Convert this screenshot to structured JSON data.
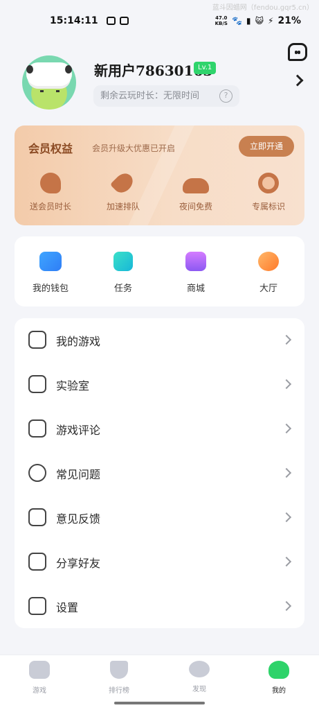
{
  "status_bar": {
    "time": "15:14:11",
    "net_speed_value": "47.0",
    "net_speed_unit": "KB/S",
    "battery": "21%"
  },
  "watermark": "蓝斗因蜡网（fendou.gqr5.cn）",
  "profile": {
    "username": "新用户78630163",
    "level": "Lv.1",
    "cloud_time_label": "剩余云玩时长：无限时间",
    "help_icon_text": "?"
  },
  "vip": {
    "title": "会员权益",
    "subtitle": "会员升级大优惠已开启",
    "open_button": "立即开通",
    "perks": [
      {
        "label": "送会员时长",
        "icon": "clock-icon"
      },
      {
        "label": "加速排队",
        "icon": "rocket-icon"
      },
      {
        "label": "夜间免费",
        "icon": "moon-cloud-icon"
      },
      {
        "label": "专属标识",
        "icon": "medal-icon"
      }
    ]
  },
  "quick_actions": [
    {
      "label": "我的钱包",
      "icon": "wallet-icon"
    },
    {
      "label": "任务",
      "icon": "task-icon"
    },
    {
      "label": "商城",
      "icon": "shop-icon"
    },
    {
      "label": "大厅",
      "icon": "hall-icon"
    }
  ],
  "menu": [
    {
      "label": "我的游戏",
      "icon": "gamepad-icon"
    },
    {
      "label": "实验室",
      "icon": "flask-icon"
    },
    {
      "label": "游戏评论",
      "icon": "pencil-icon"
    },
    {
      "label": "常见问题",
      "icon": "alert-icon"
    },
    {
      "label": "意见反馈",
      "icon": "feedback-icon"
    },
    {
      "label": "分享好友",
      "icon": "share-icon"
    },
    {
      "label": "设置",
      "icon": "settings-icon"
    }
  ],
  "tabbar": [
    {
      "label": "游戏",
      "icon": "game-tab-icon"
    },
    {
      "label": "排行榜",
      "icon": "ranking-tab-icon"
    },
    {
      "label": "发现",
      "icon": "discover-tab-icon"
    },
    {
      "label": "我的",
      "icon": "mine-tab-icon",
      "active": true
    }
  ],
  "colors": {
    "accent_green": "#2fd46c",
    "vip_brown": "#c88050",
    "background": "#f4f5f9"
  }
}
